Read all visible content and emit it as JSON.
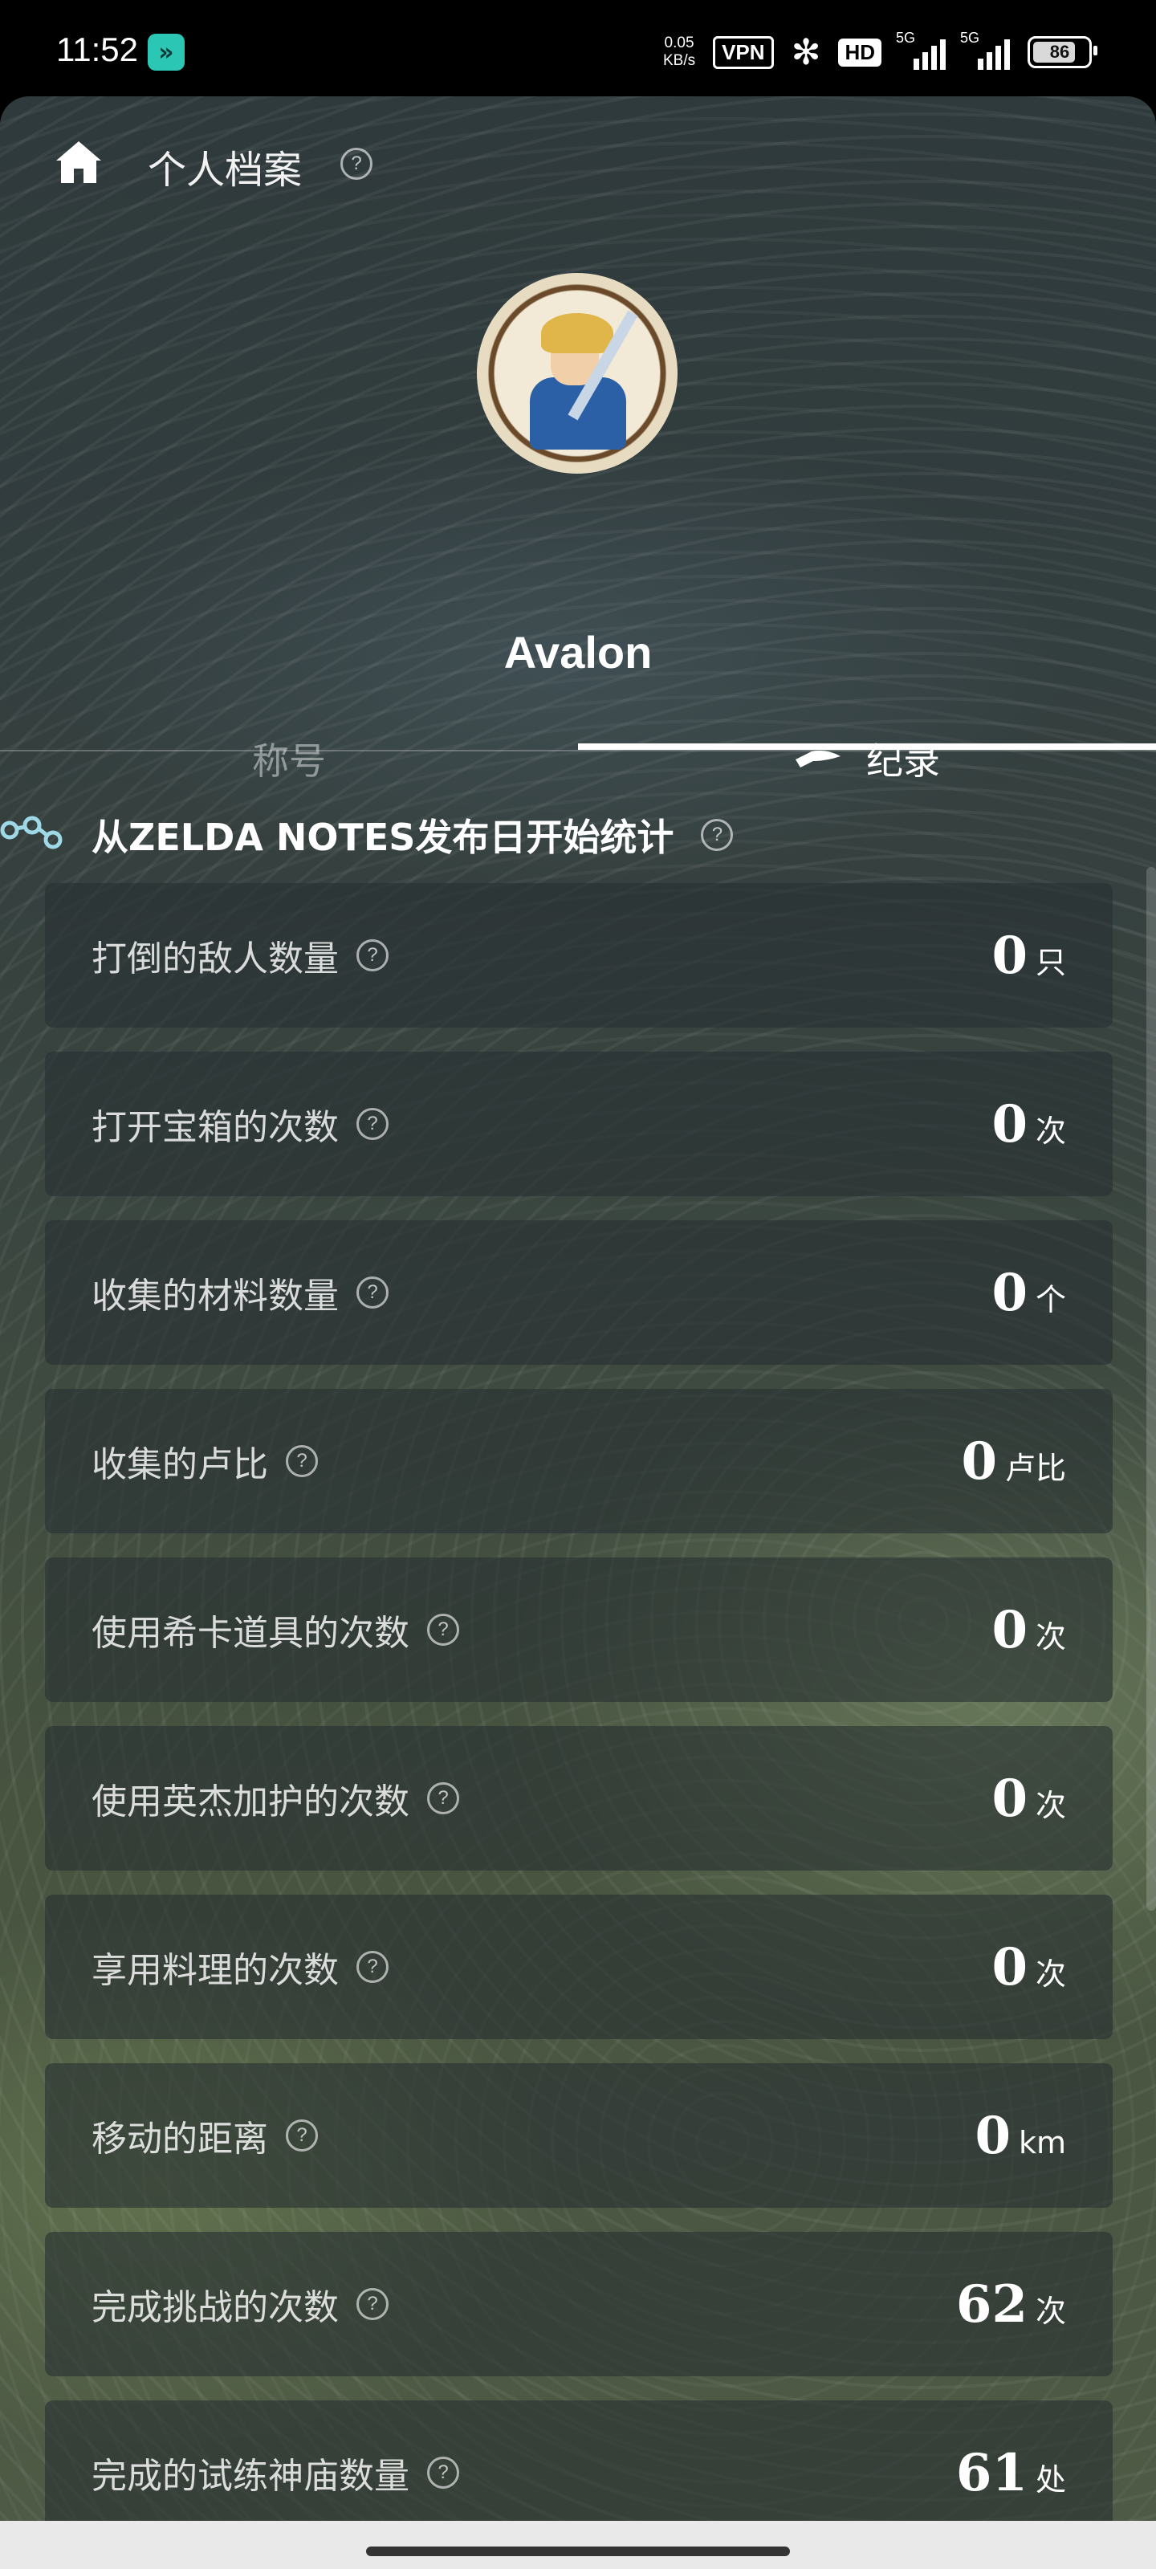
{
  "status_bar": {
    "time": "11:52",
    "net_speed_value": "0.05",
    "net_speed_unit": "KB/s",
    "vpn": "VPN",
    "hd": "HD",
    "signal1_label": "5G",
    "signal2_label": "5G",
    "battery": "86"
  },
  "header": {
    "title": "个人档案",
    "username": "Avalon"
  },
  "tabs": {
    "titles": "称号",
    "records": "纪录"
  },
  "section": {
    "title": "从ZELDA NOTES发布日开始统计"
  },
  "stats": [
    {
      "label": "打倒的敌人数量",
      "value": "0",
      "unit": "只"
    },
    {
      "label": "打开宝箱的次数",
      "value": "0",
      "unit": "次"
    },
    {
      "label": "收集的材料数量",
      "value": "0",
      "unit": "个"
    },
    {
      "label": "收集的卢比",
      "value": "0",
      "unit": "卢比"
    },
    {
      "label": "使用希卡道具的次数",
      "value": "0",
      "unit": "次"
    },
    {
      "label": "使用英杰加护的次数",
      "value": "0",
      "unit": "次"
    },
    {
      "label": "享用料理的次数",
      "value": "0",
      "unit": "次"
    },
    {
      "label": "移动的距离",
      "value": "0",
      "unit": "km"
    },
    {
      "label": "完成挑战的次数",
      "value": "62",
      "unit": "次"
    },
    {
      "label": "完成的试练神庙数量",
      "value": "61",
      "unit": "处"
    }
  ],
  "icons": {
    "help": "?"
  }
}
